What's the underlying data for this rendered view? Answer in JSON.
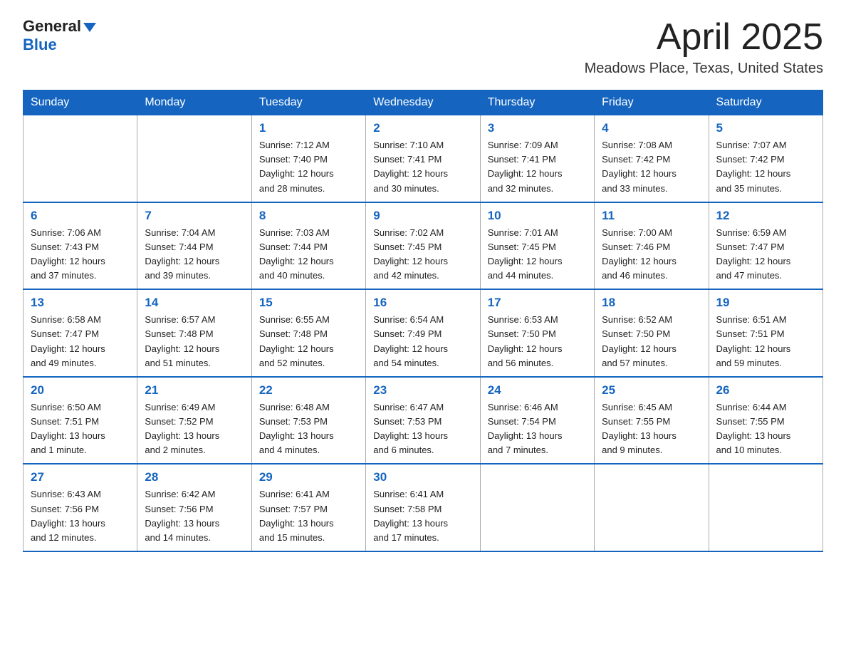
{
  "header": {
    "logo": {
      "general": "General",
      "triangle": "▶",
      "blue": "Blue"
    },
    "title": "April 2025",
    "location": "Meadows Place, Texas, United States"
  },
  "days_of_week": [
    "Sunday",
    "Monday",
    "Tuesday",
    "Wednesday",
    "Thursday",
    "Friday",
    "Saturday"
  ],
  "weeks": [
    [
      {
        "day": "",
        "info": ""
      },
      {
        "day": "",
        "info": ""
      },
      {
        "day": "1",
        "info": "Sunrise: 7:12 AM\nSunset: 7:40 PM\nDaylight: 12 hours\nand 28 minutes."
      },
      {
        "day": "2",
        "info": "Sunrise: 7:10 AM\nSunset: 7:41 PM\nDaylight: 12 hours\nand 30 minutes."
      },
      {
        "day": "3",
        "info": "Sunrise: 7:09 AM\nSunset: 7:41 PM\nDaylight: 12 hours\nand 32 minutes."
      },
      {
        "day": "4",
        "info": "Sunrise: 7:08 AM\nSunset: 7:42 PM\nDaylight: 12 hours\nand 33 minutes."
      },
      {
        "day": "5",
        "info": "Sunrise: 7:07 AM\nSunset: 7:42 PM\nDaylight: 12 hours\nand 35 minutes."
      }
    ],
    [
      {
        "day": "6",
        "info": "Sunrise: 7:06 AM\nSunset: 7:43 PM\nDaylight: 12 hours\nand 37 minutes."
      },
      {
        "day": "7",
        "info": "Sunrise: 7:04 AM\nSunset: 7:44 PM\nDaylight: 12 hours\nand 39 minutes."
      },
      {
        "day": "8",
        "info": "Sunrise: 7:03 AM\nSunset: 7:44 PM\nDaylight: 12 hours\nand 40 minutes."
      },
      {
        "day": "9",
        "info": "Sunrise: 7:02 AM\nSunset: 7:45 PM\nDaylight: 12 hours\nand 42 minutes."
      },
      {
        "day": "10",
        "info": "Sunrise: 7:01 AM\nSunset: 7:45 PM\nDaylight: 12 hours\nand 44 minutes."
      },
      {
        "day": "11",
        "info": "Sunrise: 7:00 AM\nSunset: 7:46 PM\nDaylight: 12 hours\nand 46 minutes."
      },
      {
        "day": "12",
        "info": "Sunrise: 6:59 AM\nSunset: 7:47 PM\nDaylight: 12 hours\nand 47 minutes."
      }
    ],
    [
      {
        "day": "13",
        "info": "Sunrise: 6:58 AM\nSunset: 7:47 PM\nDaylight: 12 hours\nand 49 minutes."
      },
      {
        "day": "14",
        "info": "Sunrise: 6:57 AM\nSunset: 7:48 PM\nDaylight: 12 hours\nand 51 minutes."
      },
      {
        "day": "15",
        "info": "Sunrise: 6:55 AM\nSunset: 7:48 PM\nDaylight: 12 hours\nand 52 minutes."
      },
      {
        "day": "16",
        "info": "Sunrise: 6:54 AM\nSunset: 7:49 PM\nDaylight: 12 hours\nand 54 minutes."
      },
      {
        "day": "17",
        "info": "Sunrise: 6:53 AM\nSunset: 7:50 PM\nDaylight: 12 hours\nand 56 minutes."
      },
      {
        "day": "18",
        "info": "Sunrise: 6:52 AM\nSunset: 7:50 PM\nDaylight: 12 hours\nand 57 minutes."
      },
      {
        "day": "19",
        "info": "Sunrise: 6:51 AM\nSunset: 7:51 PM\nDaylight: 12 hours\nand 59 minutes."
      }
    ],
    [
      {
        "day": "20",
        "info": "Sunrise: 6:50 AM\nSunset: 7:51 PM\nDaylight: 13 hours\nand 1 minute."
      },
      {
        "day": "21",
        "info": "Sunrise: 6:49 AM\nSunset: 7:52 PM\nDaylight: 13 hours\nand 2 minutes."
      },
      {
        "day": "22",
        "info": "Sunrise: 6:48 AM\nSunset: 7:53 PM\nDaylight: 13 hours\nand 4 minutes."
      },
      {
        "day": "23",
        "info": "Sunrise: 6:47 AM\nSunset: 7:53 PM\nDaylight: 13 hours\nand 6 minutes."
      },
      {
        "day": "24",
        "info": "Sunrise: 6:46 AM\nSunset: 7:54 PM\nDaylight: 13 hours\nand 7 minutes."
      },
      {
        "day": "25",
        "info": "Sunrise: 6:45 AM\nSunset: 7:55 PM\nDaylight: 13 hours\nand 9 minutes."
      },
      {
        "day": "26",
        "info": "Sunrise: 6:44 AM\nSunset: 7:55 PM\nDaylight: 13 hours\nand 10 minutes."
      }
    ],
    [
      {
        "day": "27",
        "info": "Sunrise: 6:43 AM\nSunset: 7:56 PM\nDaylight: 13 hours\nand 12 minutes."
      },
      {
        "day": "28",
        "info": "Sunrise: 6:42 AM\nSunset: 7:56 PM\nDaylight: 13 hours\nand 14 minutes."
      },
      {
        "day": "29",
        "info": "Sunrise: 6:41 AM\nSunset: 7:57 PM\nDaylight: 13 hours\nand 15 minutes."
      },
      {
        "day": "30",
        "info": "Sunrise: 6:41 AM\nSunset: 7:58 PM\nDaylight: 13 hours\nand 17 minutes."
      },
      {
        "day": "",
        "info": ""
      },
      {
        "day": "",
        "info": ""
      },
      {
        "day": "",
        "info": ""
      }
    ]
  ]
}
